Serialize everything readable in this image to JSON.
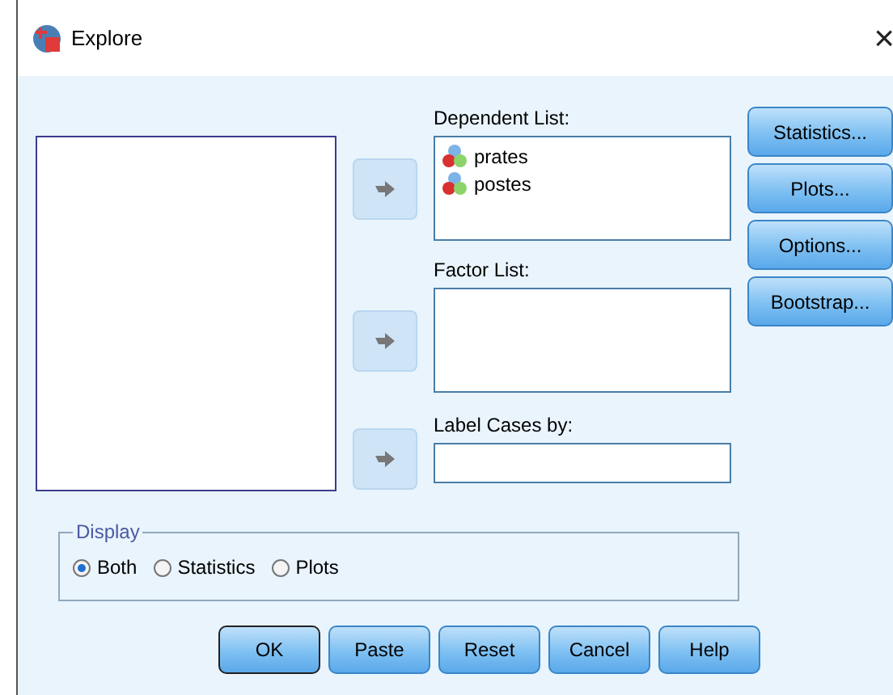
{
  "window": {
    "title": "Explore",
    "close": "×"
  },
  "dependent_list": {
    "label": "Dependent List:",
    "items": [
      {
        "name": "prates",
        "selected": false
      },
      {
        "name": "postes",
        "selected": false
      }
    ]
  },
  "factor_list": {
    "label": "Factor List:"
  },
  "label_cases": {
    "label": "Label Cases by:"
  },
  "side_buttons": [
    {
      "label": "Statistics..."
    },
    {
      "label": "Plots..."
    },
    {
      "label": "Options..."
    },
    {
      "label": "Bootstrap..."
    }
  ],
  "display": {
    "title": "Display",
    "options": [
      {
        "label": "Both",
        "selected": true
      },
      {
        "label": "Statistics",
        "selected": false
      },
      {
        "label": "Plots",
        "selected": false
      }
    ]
  },
  "buttons": [
    {
      "label": "OK",
      "default": true
    },
    {
      "label": "Paste",
      "default": false
    },
    {
      "label": "Reset",
      "default": false
    },
    {
      "label": "Cancel",
      "default": false
    },
    {
      "label": "Help",
      "default": false
    }
  ]
}
